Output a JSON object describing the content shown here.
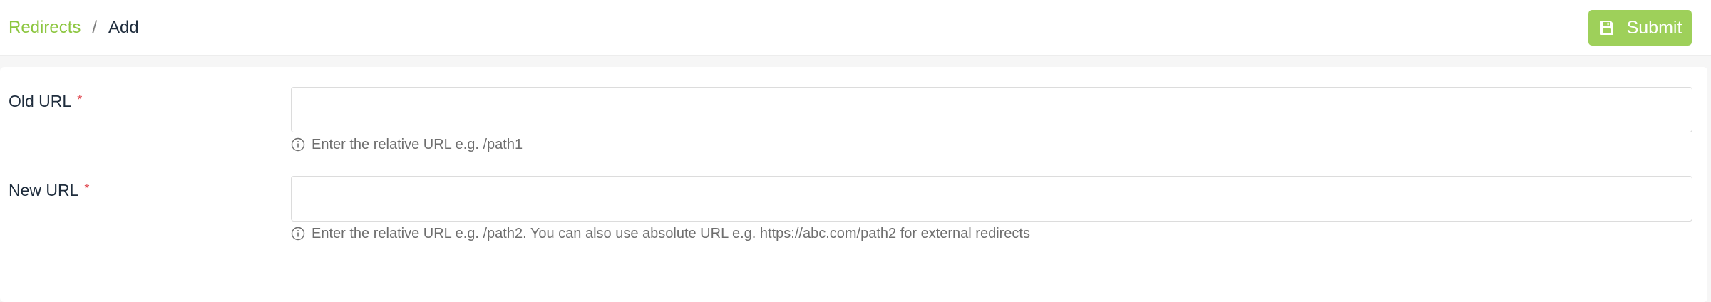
{
  "breadcrumb": {
    "parent": "Redirects",
    "separator": "/",
    "current": "Add"
  },
  "toolbar": {
    "submit_label": "Submit",
    "submit_icon": "save-icon"
  },
  "form": {
    "old_url": {
      "label": "Old URL",
      "required_mark": "*",
      "value": "",
      "placeholder": "",
      "help_icon": "info-icon",
      "help": "Enter the relative URL e.g. /path1"
    },
    "new_url": {
      "label": "New URL",
      "required_mark": "*",
      "value": "",
      "placeholder": "",
      "help_icon": "info-icon",
      "help": "Enter the relative URL e.g. /path2. You can also use absolute URL e.g. https://abc.com/path2 for external redirects"
    }
  },
  "colors": {
    "accent": "#8cc63f",
    "button": "#9ed05a",
    "required": "#e0474f",
    "text": "#1f2d3d",
    "help_text": "#6e6e6e"
  }
}
